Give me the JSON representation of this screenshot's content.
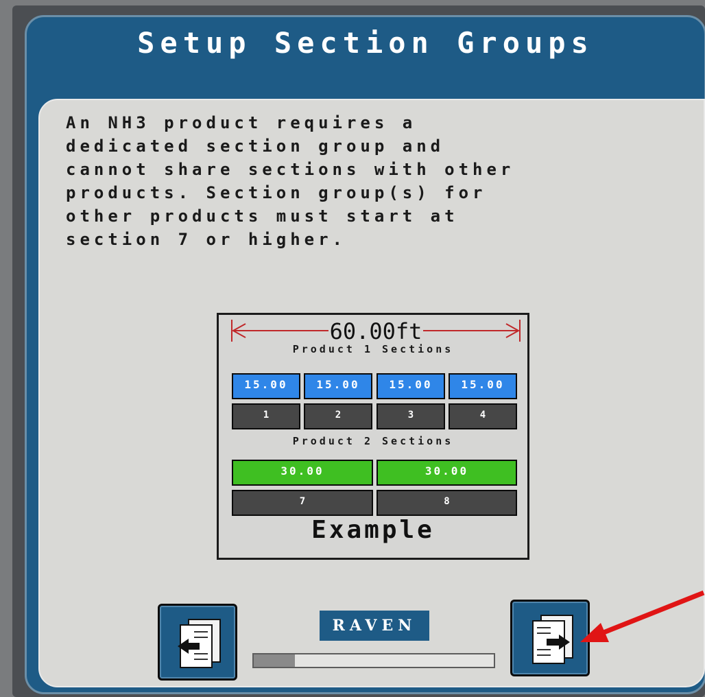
{
  "window": {
    "title": "Setup Section Groups"
  },
  "message": "An NH3 product requires a\ndedicated section group and\ncannot share sections with other\nproducts.  Section group(s) for\nother products must start at\nsection 7 or higher.",
  "example": {
    "width_label": "60.00ft",
    "product1_heading": "Product 1 Sections",
    "product1_rates": [
      "15.00",
      "15.00",
      "15.00",
      "15.00"
    ],
    "product1_sections": [
      "1",
      "2",
      "3",
      "4"
    ],
    "product2_heading": "Product 2 Sections",
    "product2_rates": [
      "30.00",
      "30.00"
    ],
    "product2_sections": [
      "7",
      "8"
    ],
    "caption": "Example"
  },
  "footer": {
    "back_icon": "page-back-icon",
    "next_icon": "page-next-icon",
    "logo_text": "RAVEN",
    "progress_fraction": 0.17
  },
  "colors": {
    "accent": "#1e5b86",
    "product1": "#2f86e8",
    "product2": "#3fbf22",
    "section": "#474747",
    "annotation_arrow": "#e01515"
  }
}
